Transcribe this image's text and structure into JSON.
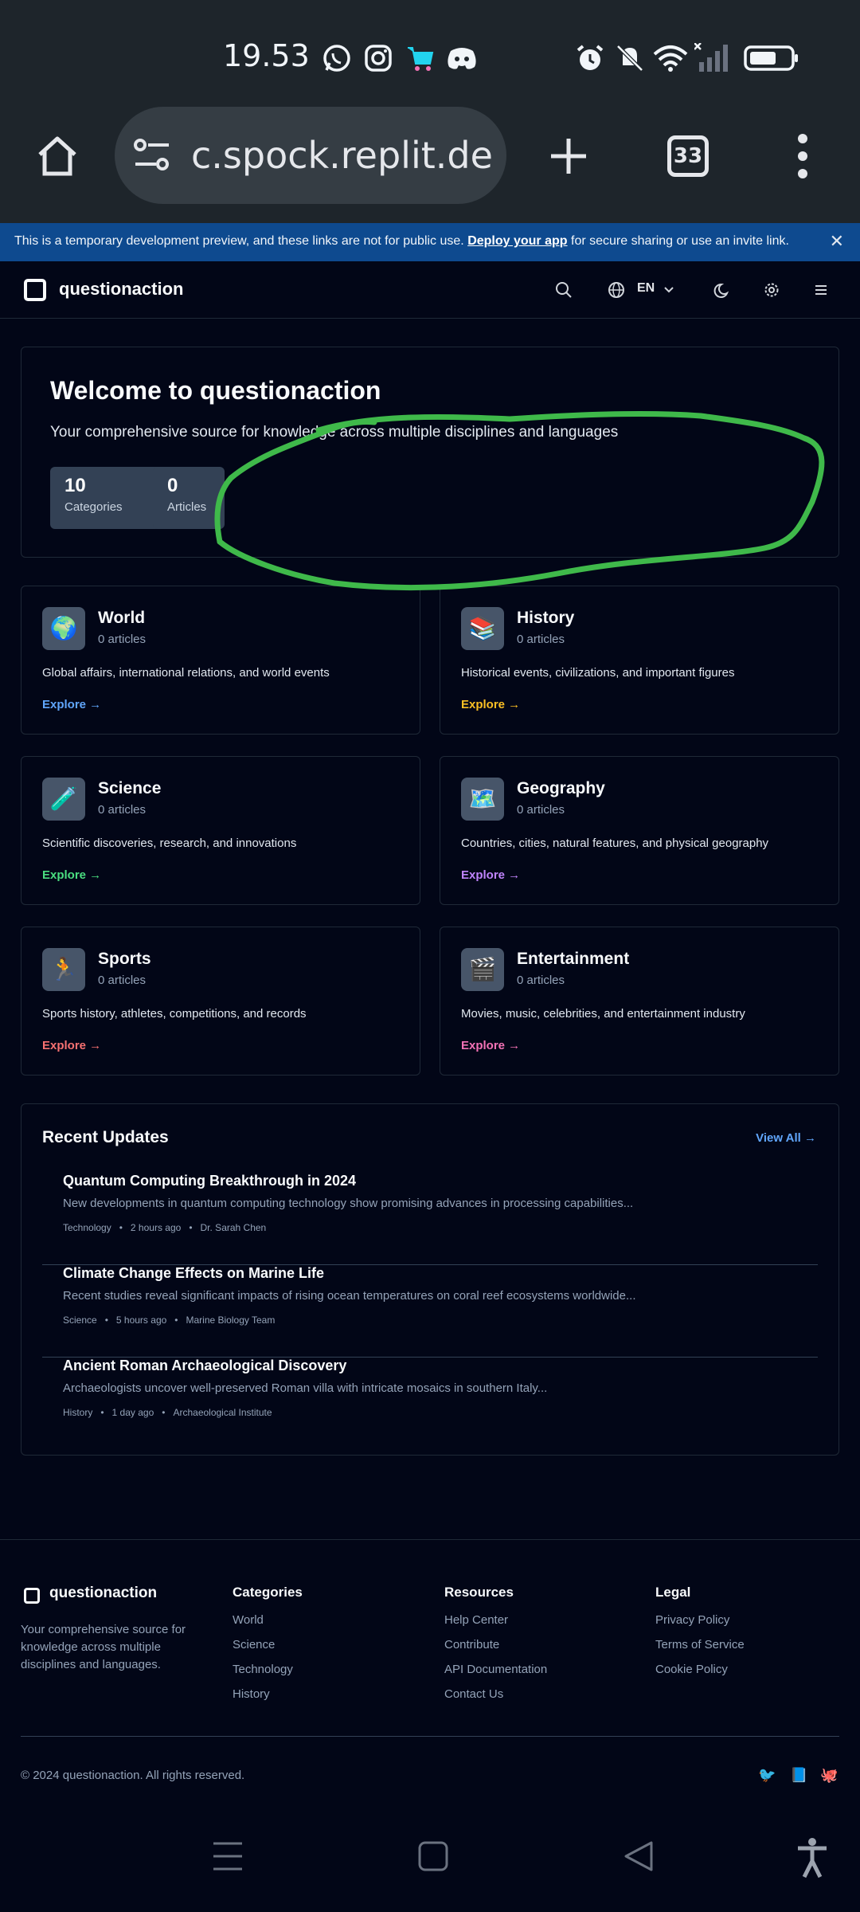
{
  "status_bar": {
    "time": "19.53"
  },
  "browser": {
    "url": "c.spock.replit.dev",
    "tab_count": "33"
  },
  "banner": {
    "text_before": "This is a temporary development preview, and these links are not for public use. ",
    "link": "Deploy your app",
    "text_after": " for secure sharing or use an invite link.",
    "close": "✕"
  },
  "header": {
    "brand": "questionaction",
    "language": "EN"
  },
  "welcome": {
    "title": "Welcome to questionaction",
    "subtitle": "Your comprehensive source for knowledge across multiple disciplines and languages",
    "stats": [
      {
        "value": "10",
        "label": "Categories"
      },
      {
        "value": "0",
        "label": "Articles"
      }
    ]
  },
  "categories": [
    {
      "icon": "🌍",
      "name": "World",
      "count": "0 articles",
      "desc": "Global affairs, international relations, and world events",
      "explore": "Explore →",
      "color": "#60a5fa"
    },
    {
      "icon": "📚",
      "name": "History",
      "count": "0 articles",
      "desc": "Historical events, civilizations, and important figures",
      "explore": "Explore →",
      "color": "#fbbf24"
    },
    {
      "icon": "🧪",
      "name": "Science",
      "count": "0 articles",
      "desc": "Scientific discoveries, research, and innovations",
      "explore": "Explore →",
      "color": "#4ade80"
    },
    {
      "icon": "🗺️",
      "name": "Geography",
      "count": "0 articles",
      "desc": "Countries, cities, natural features, and physical geography",
      "explore": "Explore →",
      "color": "#c084fc"
    },
    {
      "icon": "🏃",
      "name": "Sports",
      "count": "0 articles",
      "desc": "Sports history, athletes, competitions, and records",
      "explore": "Explore →",
      "color": "#f87171"
    },
    {
      "icon": "🎬",
      "name": "Entertainment",
      "count": "0 articles",
      "desc": "Movies, music, celebrities, and entertainment industry",
      "explore": "Explore →",
      "color": "#f472b6"
    }
  ],
  "recent": {
    "title": "Recent Updates",
    "view_all": "View All →",
    "items": [
      {
        "title": "Quantum Computing Breakthrough in 2024",
        "desc": "New developments in quantum computing technology show promising advances in processing capabilities...",
        "category": "Technology",
        "time": "2 hours ago",
        "author": "Dr. Sarah Chen"
      },
      {
        "title": "Climate Change Effects on Marine Life",
        "desc": "Recent studies reveal significant impacts of rising ocean temperatures on coral reef ecosystems worldwide...",
        "category": "Science",
        "time": "5 hours ago",
        "author": "Marine Biology Team"
      },
      {
        "title": "Ancient Roman Archaeological Discovery",
        "desc": "Archaeologists uncover well-preserved Roman villa with intricate mosaics in southern Italy...",
        "category": "History",
        "time": "1 day ago",
        "author": "Archaeological Institute"
      }
    ]
  },
  "footer": {
    "brand": "questionaction",
    "desc": "Your comprehensive source for knowledge across multiple disciplines and languages.",
    "columns": [
      {
        "title": "Categories",
        "links": [
          "World",
          "Science",
          "Technology",
          "History"
        ]
      },
      {
        "title": "Resources",
        "links": [
          "Help Center",
          "Contribute",
          "API Documentation",
          "Contact Us"
        ]
      },
      {
        "title": "Legal",
        "links": [
          "Privacy Policy",
          "Terms of Service",
          "Cookie Policy"
        ]
      }
    ],
    "copyright": "© 2024 questionaction. All rights reserved.",
    "social": [
      "🐦",
      "📘",
      "🐙"
    ]
  }
}
